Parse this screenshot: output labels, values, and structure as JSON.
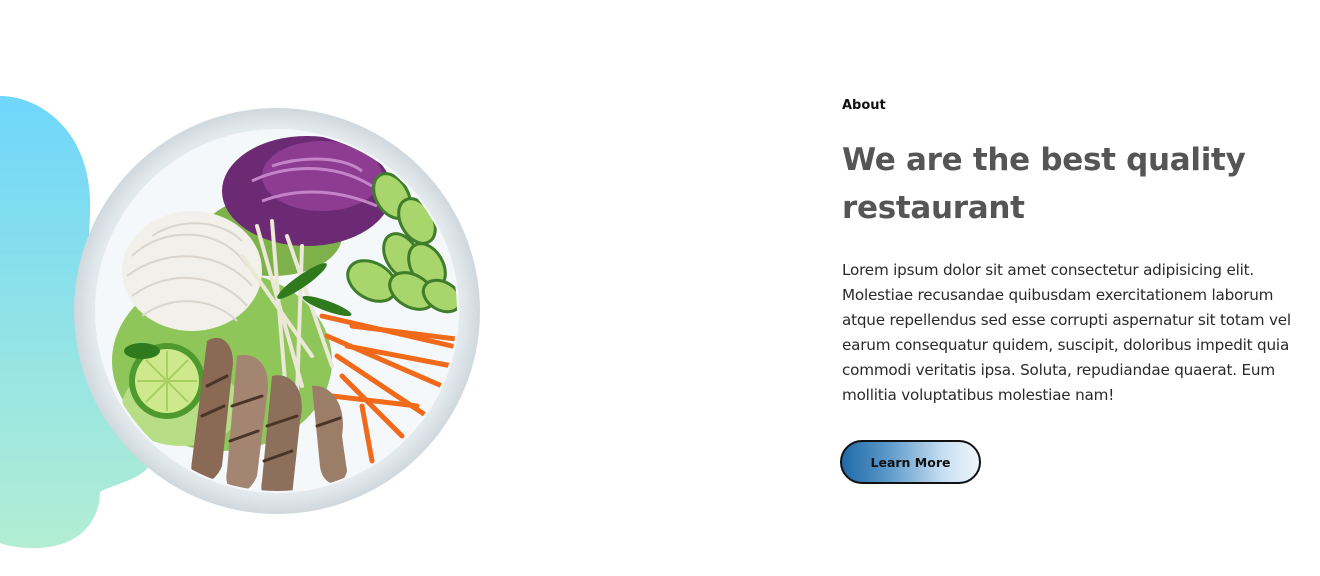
{
  "about": {
    "eyebrow": "About",
    "heading": "We are the best quality restaurant",
    "body": "Lorem ipsum dolor sit amet consectetur adipisicing elit. Molestiae recusandae quibusdam exercitationem laborum atque repellendus sed esse corrupti aspernatur sit totam vel earum consequatur quidem, suscipit, doloribus impedit quia commodi veritatis ipsa. Soluta, repudiandae quaerat. Eum mollitia voluptatibus molestiae nam!",
    "button_label": "Learn More"
  },
  "colors": {
    "blob_top": "#6fd6fb",
    "blob_bottom": "#b2eed3",
    "heading": "#555555",
    "button_start": "#1f6aa8",
    "button_end": "#eef6fc"
  },
  "images": {
    "dish": "food-bowl-image",
    "blob": "gradient-blob-shape"
  }
}
